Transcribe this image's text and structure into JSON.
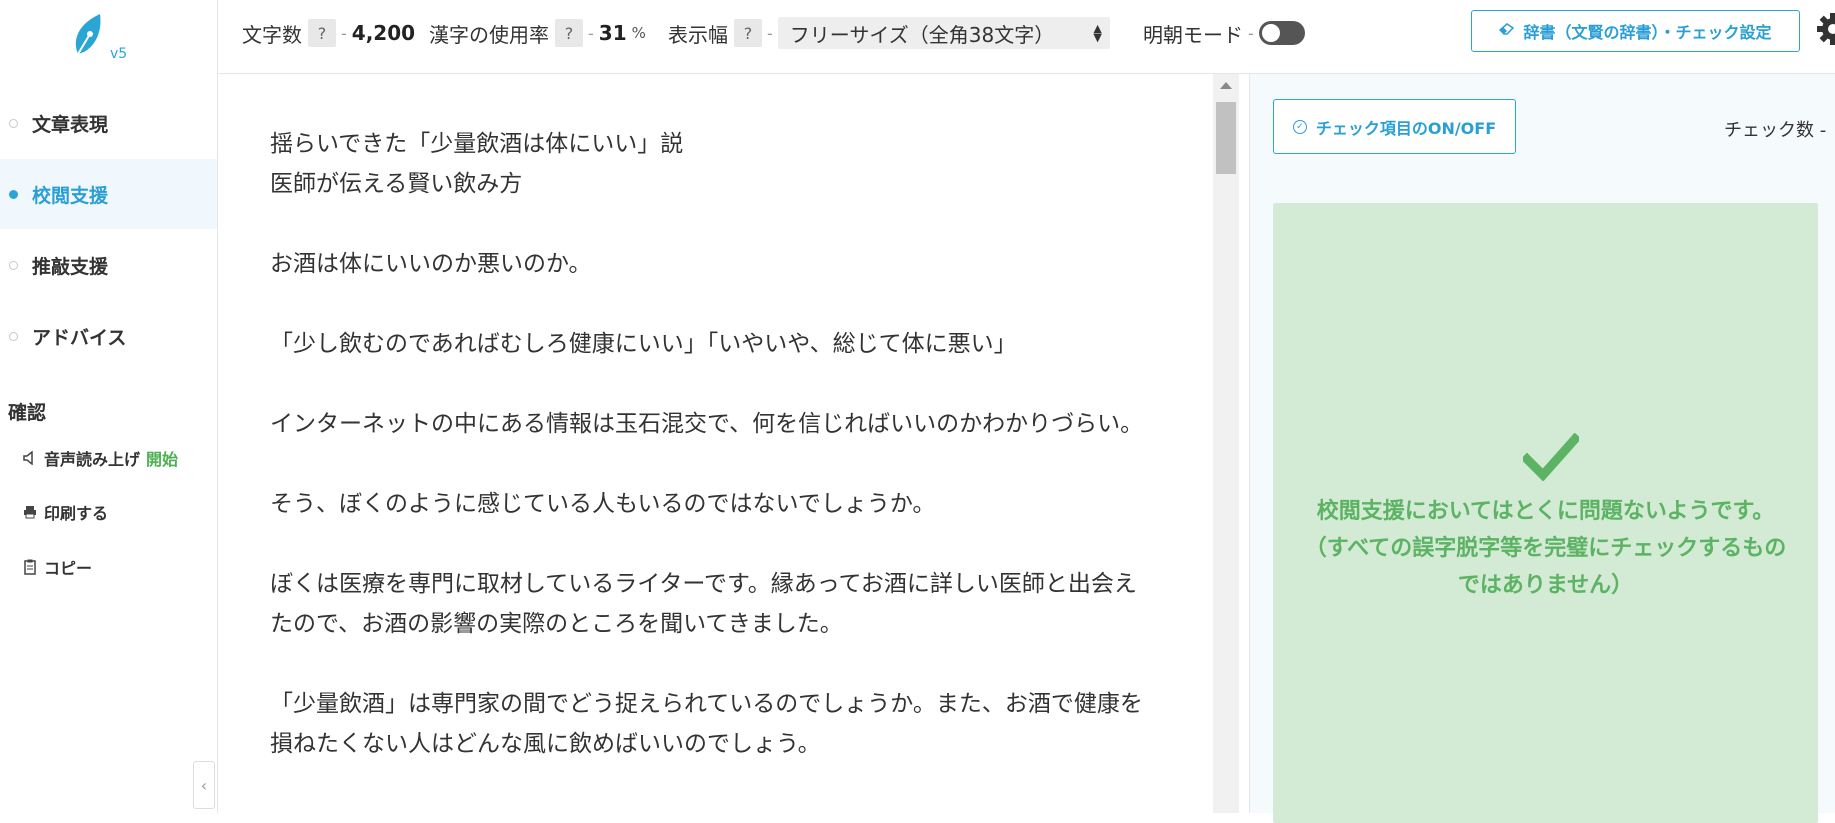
{
  "sidebar": {
    "logo_version": "v5",
    "nav": [
      {
        "label": "文章表現",
        "active": false
      },
      {
        "label": "校閲支援",
        "active": true
      },
      {
        "label": "推敲支援",
        "active": false
      },
      {
        "label": "アドバイス",
        "active": false
      }
    ],
    "confirm_heading": "確認",
    "tools": {
      "speech_label": "音声読み上げ",
      "speech_start": "開始",
      "print_label": "印刷する",
      "copy_label": "コピー"
    },
    "collapse_glyph": "‹"
  },
  "topbar": {
    "char_count_label": "文字数",
    "char_count_value": "4,200",
    "kanji_label": "漢字の使用率",
    "kanji_value": "31",
    "kanji_unit": "%",
    "width_label": "表示幅",
    "width_value": "フリーサイズ（全角38文字）",
    "mincho_label": "明朝モード",
    "mincho_on": false,
    "help": "?",
    "dash": "-",
    "dict_button": "辞書（文賢の辞書）・チェック設定"
  },
  "editor": {
    "lines": [
      "揺らいできた「少量飲酒は体にいい」説",
      "医師が伝える賢い飲み方",
      "",
      "お酒は体にいいのか悪いのか。",
      "",
      "「少し飲むのであればむしろ健康にいい」「いやいや、総じて体に悪い」",
      "",
      "インターネットの中にある情報は玉石混交で、何を信じればいいのかわかりづらい。",
      "",
      "そう、ぼくのように感じている人もいるのではないでしょうか。",
      "",
      "ぼくは医療を専門に取材しているライターです。縁あってお酒に詳しい医師と出会え",
      "たので、お酒の影響の実際のところを聞いてきました。",
      "",
      "「少量飲酒」は専門家の間でどう捉えられているのでしょうか。また、お酒で健康を",
      "損ねたくない人はどんな風に飲めばいいのでしょう。"
    ]
  },
  "right_panel": {
    "check_toggle_button": "チェック項目のON/OFF",
    "check_count": "チェック数 -",
    "result_line1": "校閲支援においてはとくに問題ないようです。",
    "result_line2": "（すべての誤字脱字等を完璧にチェックするもの",
    "result_line3": "ではありません）"
  },
  "colors": {
    "accent": "#2aa6d6",
    "success": "#5cb363",
    "success_bg": "#d3ead5"
  }
}
